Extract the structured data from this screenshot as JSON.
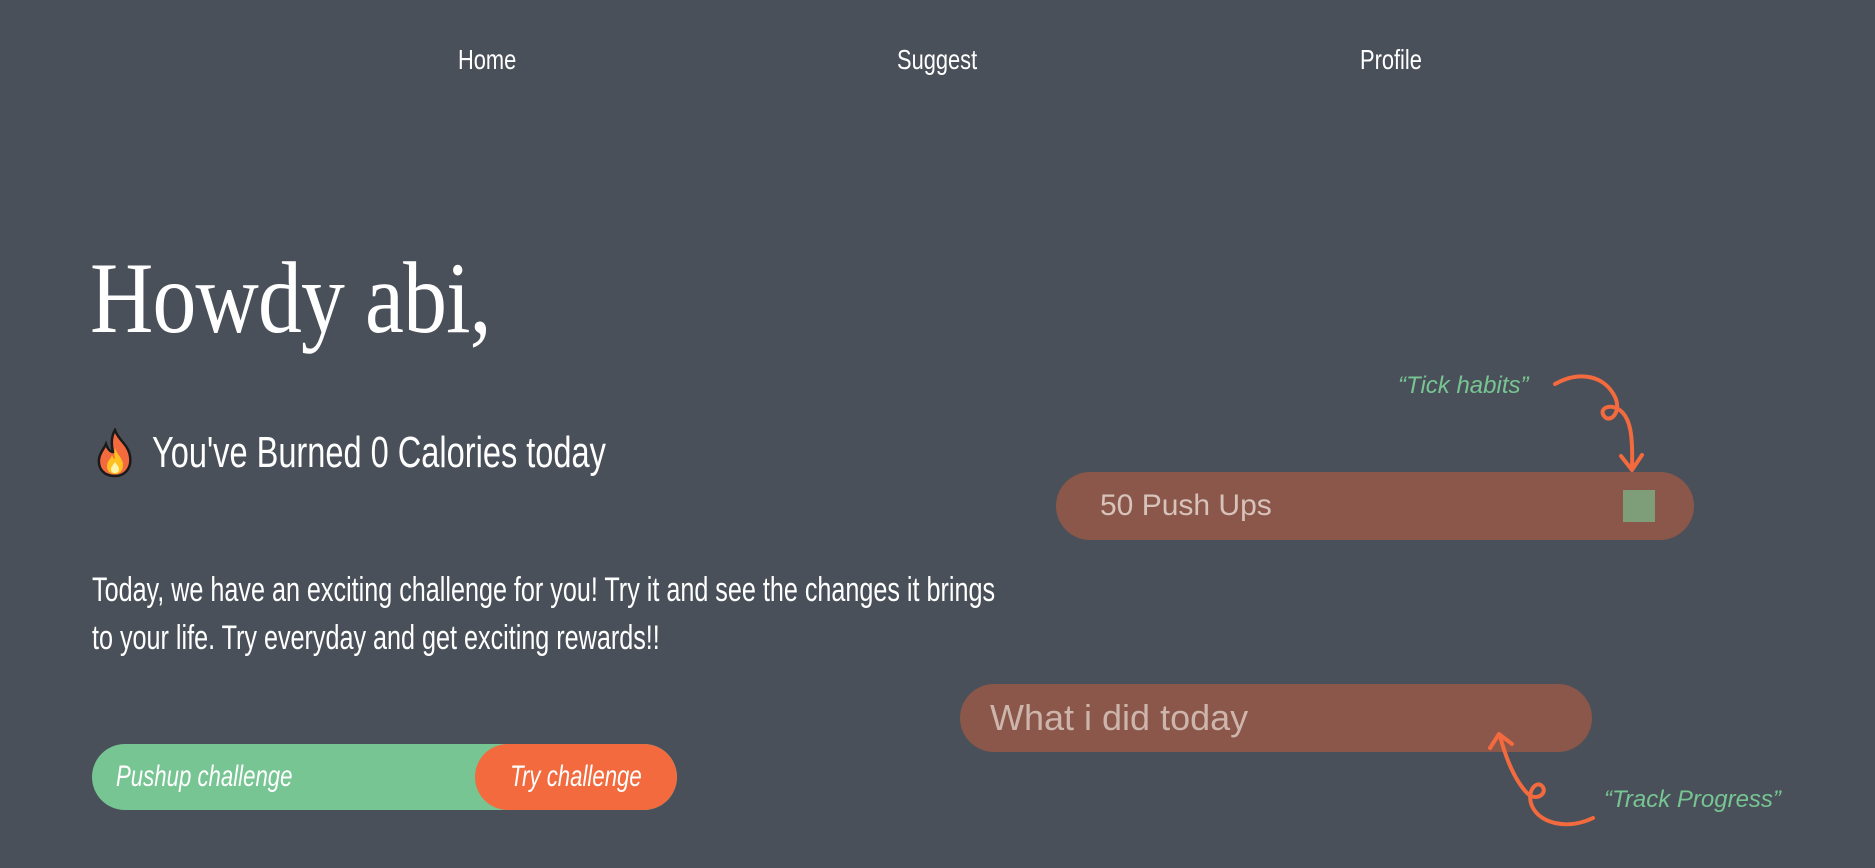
{
  "nav": {
    "home": "Home",
    "suggest": "Suggest",
    "profile": "Profile"
  },
  "greeting": "Howdy abi,",
  "calories": {
    "icon": "fire-icon",
    "text": "You've Burned 0 Calories today"
  },
  "intro": "Today, we have an exciting challenge for you! Try it and see the changes it brings to your life. Try everyday and get exciting rewards!!",
  "challenge": {
    "label": "Pushup challenge",
    "button": "Try challenge"
  },
  "habit": {
    "label": "50 Push Ups",
    "checked": false
  },
  "today_input": {
    "placeholder": "What i did today",
    "value": ""
  },
  "annotations": {
    "tick": "“Tick habits”",
    "progress": "“Track Progress”"
  },
  "colors": {
    "background": "#4a5059",
    "green": "#76c593",
    "orange": "#f26a3e",
    "brown": "#8a574a",
    "check": "#7e9e7a"
  }
}
